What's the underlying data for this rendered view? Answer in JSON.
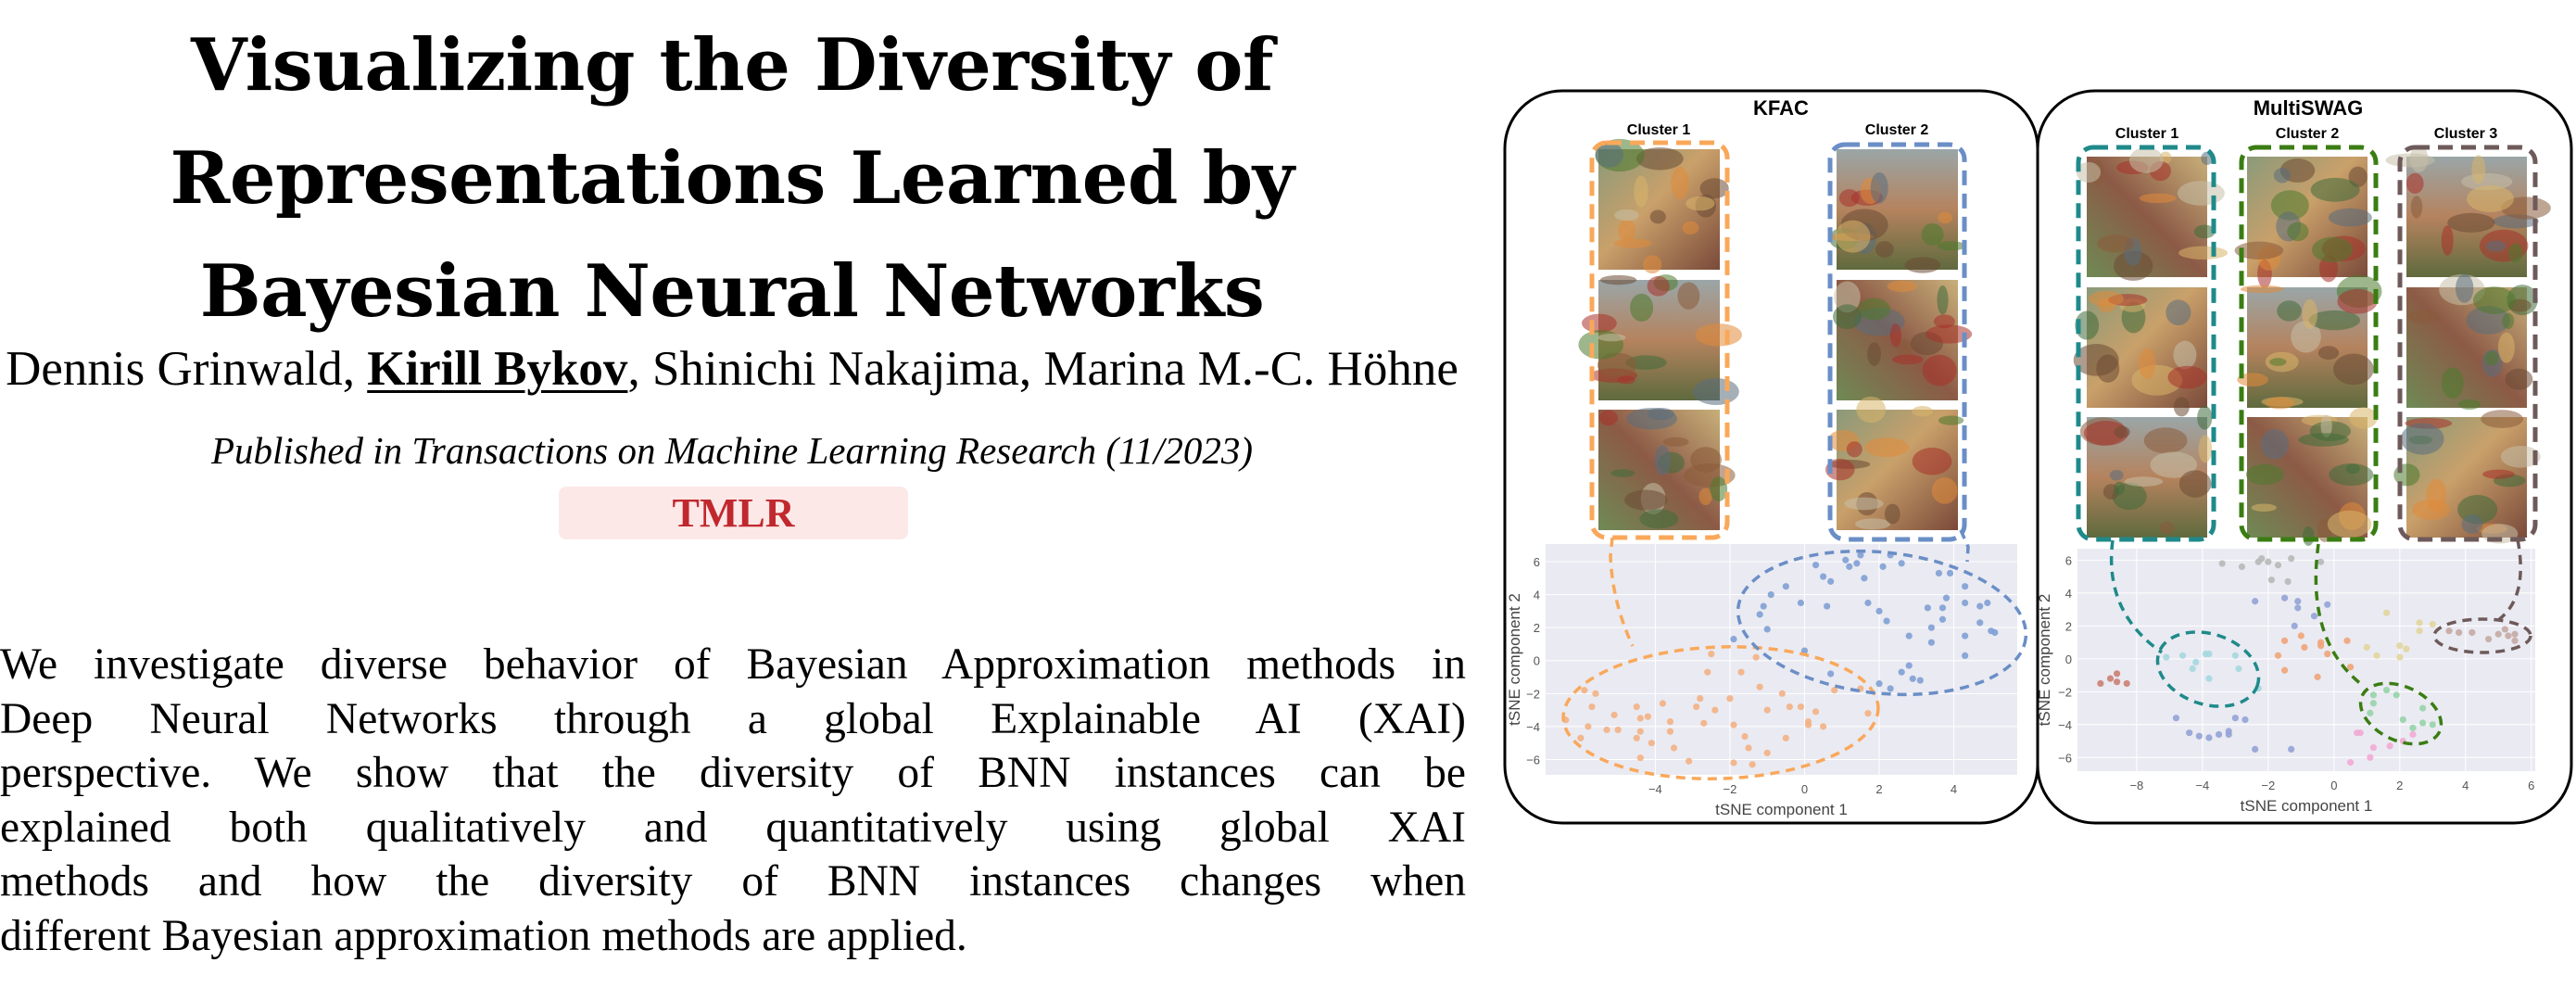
{
  "title_lines": [
    "Visualizing the Diversity of",
    "Representations Learned by",
    "Bayesian Neural Networks"
  ],
  "authors": {
    "a1": "Dennis Grinwald, ",
    "a2": "Kirill Bykov",
    "a3": ", Shinichi Nakajima, Marina M.-C. Höhne"
  },
  "venue": "Published in Transactions on Machine Learning Research (11/2023)",
  "badge": "TMLR",
  "abstract_lines": [
    "We investigate diverse behavior of Bayesian Approximation methods in",
    "Deep Neural Networks through a global Explainable AI (XAI)",
    "perspective. We show that the diversity of BNN instances can be",
    "explained both qualitatively and quantitatively using global XAI",
    "methods and how the diversity of BNN instances changes when",
    "different Bayesian approximation methods are applied."
  ],
  "chart_data": [
    {
      "type": "scatter",
      "title": "KFAC",
      "xlabel": "tSNE component 1",
      "ylabel": "tSNE component 2",
      "xlim": [
        -6.94,
        5.7
      ],
      "ylim": [
        -6.93,
        7.07
      ],
      "xticks": [
        -4,
        -2,
        0,
        2,
        4
      ],
      "xtick_labels": [
        "−4",
        "−2",
        "0",
        "2",
        "4"
      ],
      "yticks": [
        -6,
        -4,
        -2,
        0,
        2,
        4,
        6
      ],
      "ytick_labels": [
        "−6",
        "−4",
        "−2",
        "0",
        "2",
        "4",
        "6"
      ],
      "grid": true,
      "clusters": [
        "Cluster 1",
        "Cluster 2"
      ],
      "series": [
        {
          "name": "Cluster 1",
          "color": "#f3b184",
          "box_color": "#f9a85a",
          "points": [
            [
              -2.5,
              0.4
            ],
            [
              -2.6,
              -0.7
            ],
            [
              -1.7,
              -0.7
            ],
            [
              -1.3,
              0.2
            ],
            [
              -5.9,
              -1.8
            ],
            [
              -5.6,
              -2.0
            ],
            [
              -5.7,
              -2.8
            ],
            [
              -5.1,
              -3.3
            ],
            [
              -5.8,
              -4.0
            ],
            [
              -6.4,
              -3.6
            ],
            [
              -6.0,
              -4.7
            ],
            [
              -5.3,
              -4.2
            ],
            [
              -5.0,
              -4.2
            ],
            [
              -4.5,
              -2.8
            ],
            [
              -4.4,
              -3.5
            ],
            [
              -4.2,
              -3.4
            ],
            [
              -4.4,
              -4.3
            ],
            [
              -4.5,
              -4.7
            ],
            [
              -4.1,
              -5.0
            ],
            [
              -4.4,
              -5.9
            ],
            [
              -3.8,
              -2.6
            ],
            [
              -3.6,
              -3.7
            ],
            [
              -3.6,
              -4.3
            ],
            [
              -3.5,
              -5.3
            ],
            [
              -3.1,
              -6.1
            ],
            [
              -2.9,
              -2.8
            ],
            [
              -2.8,
              -2.3
            ],
            [
              -2.4,
              -3.0
            ],
            [
              -2.7,
              -3.8
            ],
            [
              -2.0,
              -2.3
            ],
            [
              -1.9,
              -3.9
            ],
            [
              -1.9,
              -6.2
            ],
            [
              -1.6,
              -4.6
            ],
            [
              -1.5,
              -5.3
            ],
            [
              -1.4,
              -6.3
            ],
            [
              -1.2,
              -1.6
            ],
            [
              -1.0,
              -3.0
            ],
            [
              -1.0,
              -5.6
            ],
            [
              -0.6,
              -2.0
            ],
            [
              -0.4,
              -2.8
            ],
            [
              -0.5,
              -4.7
            ],
            [
              -0.1,
              -2.8
            ],
            [
              0.1,
              -3.7
            ],
            [
              0.1,
              -3.9
            ],
            [
              0.3,
              -3.1
            ],
            [
              0.5,
              -4.0
            ],
            [
              0.8,
              -1.8
            ],
            [
              1.5,
              -1.7
            ],
            [
              1.7,
              -3.2
            ]
          ]
        },
        {
          "name": "Cluster 2",
          "color": "#7fa0d4",
          "box_color": "#6a8ec6",
          "points": [
            [
              0.3,
              5.8
            ],
            [
              1.1,
              6.1
            ],
            [
              1.2,
              5.7
            ],
            [
              1.4,
              5.9
            ],
            [
              1.5,
              6.4
            ],
            [
              2.1,
              5.7
            ],
            [
              2.3,
              6.4
            ],
            [
              2.6,
              5.9
            ],
            [
              0.5,
              5.1
            ],
            [
              0.7,
              4.8
            ],
            [
              1.6,
              5.0
            ],
            [
              3.6,
              5.3
            ],
            [
              3.9,
              5.3
            ],
            [
              -0.5,
              4.5
            ],
            [
              -0.9,
              4.0
            ],
            [
              -1.1,
              3.3
            ],
            [
              -1.2,
              2.8
            ],
            [
              -1.0,
              1.9
            ],
            [
              -0.1,
              3.5
            ],
            [
              0.6,
              3.3
            ],
            [
              1.7,
              3.5
            ],
            [
              2.0,
              3.0
            ],
            [
              2.2,
              2.4
            ],
            [
              3.3,
              3.2
            ],
            [
              3.7,
              3.2
            ],
            [
              3.8,
              3.8
            ],
            [
              3.7,
              2.5
            ],
            [
              3.4,
              2.0
            ],
            [
              3.4,
              1.1
            ],
            [
              2.8,
              1.5
            ],
            [
              4.3,
              4.5
            ],
            [
              4.3,
              3.5
            ],
            [
              4.7,
              3.3
            ],
            [
              4.9,
              3.5
            ],
            [
              4.7,
              2.3
            ],
            [
              5.0,
              1.8
            ],
            [
              5.1,
              1.7
            ],
            [
              4.3,
              1.5
            ],
            [
              4.3,
              0.3
            ],
            [
              -1.9,
              1.3
            ],
            [
              0.0,
              0.6
            ],
            [
              0.7,
              -0.8
            ],
            [
              2.6,
              -0.7
            ],
            [
              2.8,
              -0.3
            ],
            [
              2.9,
              -1.1
            ],
            [
              3.1,
              -1.2
            ],
            [
              2.0,
              -1.4
            ],
            [
              2.3,
              -1.7
            ]
          ]
        }
      ]
    },
    {
      "type": "scatter",
      "title": "MultiSWAG",
      "xlabel": "tSNE component 1",
      "ylabel": "tSNE component 2",
      "xlim": [
        -7.8,
        6.12
      ],
      "ylim": [
        -6.83,
        6.7
      ],
      "xticks": [
        -6,
        -4,
        -2,
        0,
        2,
        4,
        6
      ],
      "xtick_labels": [
        "−8",
        "−4",
        "−2",
        "0",
        "2",
        "4",
        "6"
      ],
      "yticks": [
        -6,
        -4,
        -2,
        0,
        2,
        4,
        6
      ],
      "ytick_labels": [
        "−6",
        "−4",
        "−2",
        "0",
        "2",
        "4",
        "6"
      ],
      "grid": true,
      "clusters": [
        "Cluster 1",
        "Cluster 2",
        "Cluster 3"
      ],
      "box_colors": [
        "#1f8a8a",
        "#3a7d12",
        "#6e5a5a"
      ],
      "series": [
        {
          "name": "grey",
          "color": "#b8b8b8",
          "points": [
            [
              -3.4,
              5.8
            ],
            [
              -2.8,
              5.6
            ],
            [
              -2.3,
              5.9
            ],
            [
              -2.2,
              6.1
            ],
            [
              -2.0,
              5.9
            ],
            [
              -1.7,
              5.7
            ],
            [
              -1.3,
              6.1
            ],
            [
              -0.4,
              5.9
            ],
            [
              -1.9,
              4.8
            ],
            [
              -1.4,
              4.7
            ]
          ]
        },
        {
          "name": "blue",
          "color": "#93a3d6",
          "points": [
            [
              -1.5,
              3.7
            ],
            [
              -1.1,
              3.5
            ],
            [
              -1.1,
              3.1
            ],
            [
              -2.4,
              3.5
            ],
            [
              -0.2,
              3.3
            ],
            [
              -0.6,
              2.6
            ],
            [
              -1.2,
              2.0
            ],
            [
              -4.8,
              -3.6
            ],
            [
              -4.4,
              -4.5
            ],
            [
              -4.1,
              -4.7
            ],
            [
              -3.8,
              -4.8
            ],
            [
              -3.5,
              -4.6
            ],
            [
              -3.2,
              -4.4
            ],
            [
              -3.2,
              -4.6
            ],
            [
              -3.0,
              -3.6
            ],
            [
              -2.7,
              -3.7
            ],
            [
              -2.4,
              -5.5
            ],
            [
              -1.3,
              -5.5
            ]
          ]
        },
        {
          "name": "cyan",
          "color": "#a5d8df",
          "points": [
            [
              -5.1,
              0.1
            ],
            [
              -4.6,
              0.2
            ],
            [
              -4.2,
              -0.2
            ],
            [
              -4.3,
              -0.6
            ],
            [
              -3.9,
              0.3
            ],
            [
              -3.8,
              0.3
            ],
            [
              -3.8,
              -1.2
            ],
            [
              -3.0,
              0.2
            ],
            [
              -2.9,
              -0.6
            ],
            [
              -2.3,
              -1.8
            ]
          ]
        },
        {
          "name": "red",
          "color": "#cc7f73",
          "points": [
            [
              -7.1,
              -1.5
            ],
            [
              -6.8,
              -1.2
            ],
            [
              -6.6,
              -0.9
            ],
            [
              -6.6,
              -1.4
            ],
            [
              -6.3,
              -1.5
            ]
          ]
        },
        {
          "name": "orange",
          "color": "#f0a478",
          "points": [
            [
              -1.5,
              1.1
            ],
            [
              -1.0,
              1.4
            ],
            [
              -0.9,
              0.7
            ],
            [
              -0.4,
              1.0
            ],
            [
              -0.4,
              0.8
            ],
            [
              0.4,
              1.1
            ],
            [
              -0.2,
              0.3
            ],
            [
              -1.7,
              0.2
            ],
            [
              -1.5,
              -0.7
            ],
            [
              -0.5,
              -1.1
            ],
            [
              0.5,
              -0.5
            ]
          ]
        },
        {
          "name": "olive",
          "color": "#e2d59c",
          "points": [
            [
              1.6,
              2.8
            ],
            [
              2.6,
              2.2
            ],
            [
              2.6,
              1.7
            ],
            [
              3.0,
              2.1
            ],
            [
              1.0,
              0.7
            ],
            [
              1.3,
              0.2
            ],
            [
              2.0,
              0.8
            ],
            [
              2.2,
              0.6
            ],
            [
              2.0,
              0.1
            ]
          ]
        },
        {
          "name": "green",
          "color": "#96d4a8",
          "points": [
            [
              1.2,
              -2.2
            ],
            [
              1.2,
              -2.7
            ],
            [
              1.1,
              -3.3
            ],
            [
              1.6,
              -1.9
            ],
            [
              1.9,
              -2.2
            ],
            [
              2.1,
              -3.7
            ],
            [
              2.4,
              -4.2
            ],
            [
              2.7,
              -3.0
            ],
            [
              2.7,
              -3.9
            ],
            [
              3.0,
              -4.0
            ]
          ]
        },
        {
          "name": "pink",
          "color": "#f2aad4",
          "points": [
            [
              0.7,
              -4.5
            ],
            [
              0.8,
              -4.5
            ],
            [
              1.2,
              -5.4
            ],
            [
              1.7,
              -5.3
            ],
            [
              2.1,
              -5.0
            ],
            [
              2.4,
              -4.6
            ],
            [
              0.5,
              -6.3
            ],
            [
              1.1,
              -6.0
            ]
          ]
        },
        {
          "name": "brown",
          "color": "#c4aaa3",
          "points": [
            [
              3.5,
              1.7
            ],
            [
              3.8,
              1.6
            ],
            [
              4.2,
              1.6
            ],
            [
              4.7,
              1.2
            ],
            [
              5.0,
              1.5
            ],
            [
              5.2,
              1.8
            ],
            [
              5.3,
              1.4
            ],
            [
              5.5,
              1.5
            ],
            [
              5.5,
              1.1
            ]
          ]
        }
      ]
    }
  ]
}
